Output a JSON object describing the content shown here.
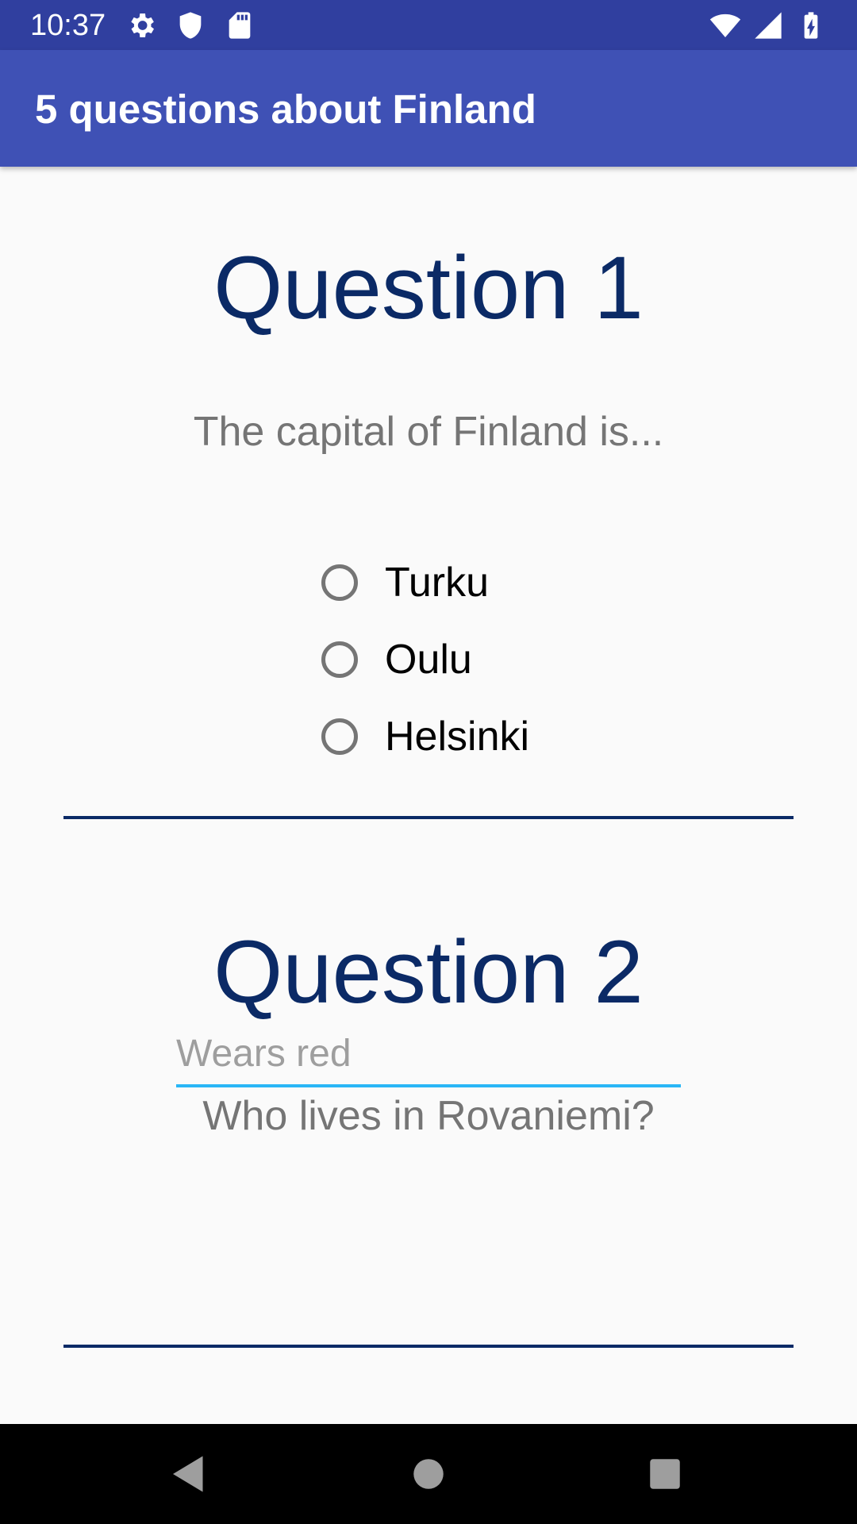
{
  "status_bar": {
    "time": "10:37",
    "left_icons": [
      "settings-icon",
      "shield-icon",
      "sd-card-icon"
    ],
    "right_icons": [
      "wifi-icon",
      "signal-icon",
      "battery-charging-icon"
    ],
    "color": "#303f9f"
  },
  "app_bar": {
    "title": "5 questions about Finland",
    "color": "#3f51b5"
  },
  "questions": [
    {
      "title": "Question 1",
      "text": "The capital of Finland is...",
      "options": [
        "Turku",
        "Oulu",
        "Helsinki"
      ]
    },
    {
      "title": "Question 2",
      "text": "Who lives in Rovaniemi?",
      "answer": {
        "value": "",
        "placeholder": "Wears red"
      }
    }
  ],
  "colors": {
    "question_title": "#0b2a66",
    "divider": "#0b2a66",
    "field_underline": "#29b6f6"
  },
  "nav_bar": {
    "buttons": [
      "back-icon",
      "home-icon",
      "recents-icon"
    ]
  }
}
